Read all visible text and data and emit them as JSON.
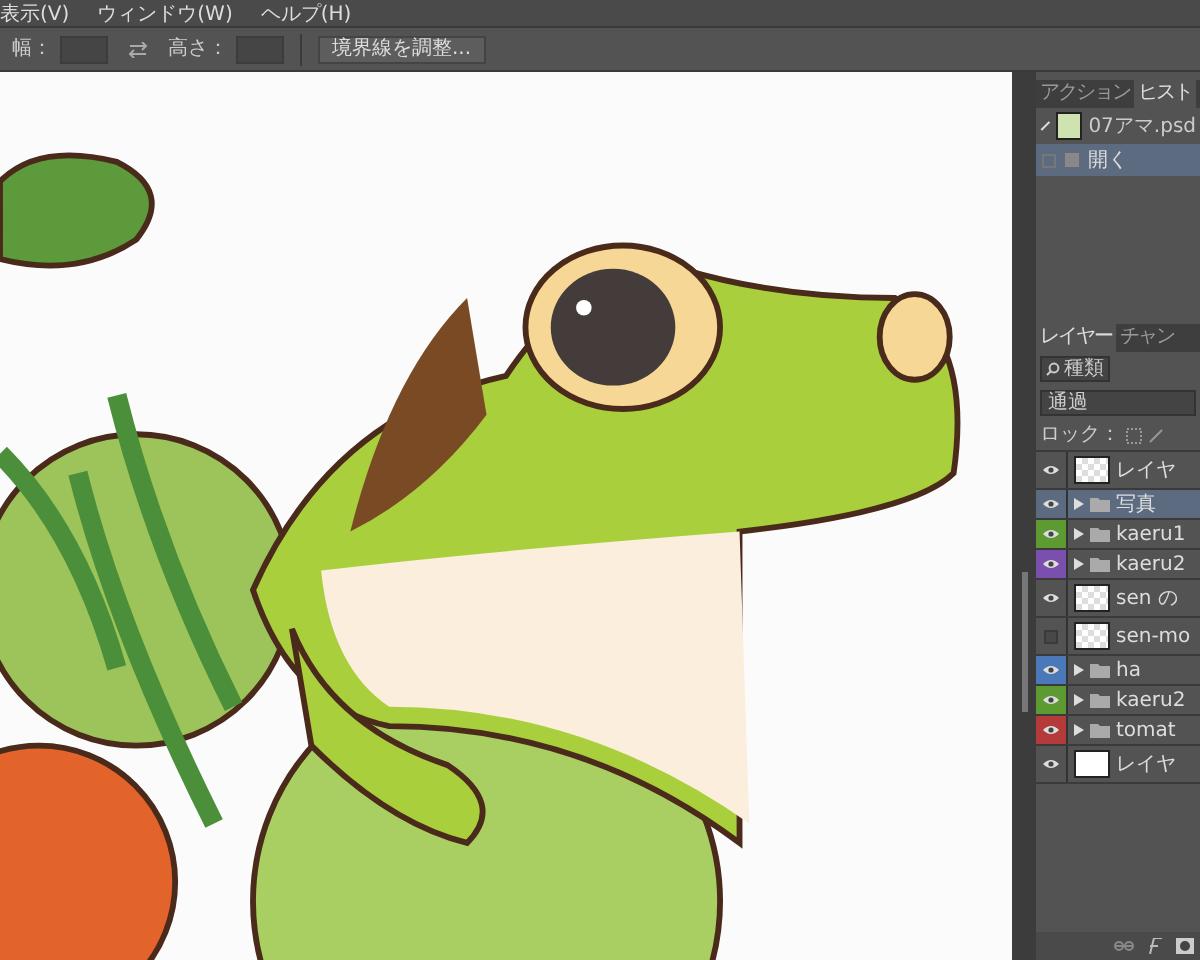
{
  "menu": [
    "表示(V)",
    "ウィンドウ(W)",
    "ヘルプ(H)"
  ],
  "options": {
    "width_label": "幅：",
    "height_label": "高さ：",
    "refine_button": "境界線を調整..."
  },
  "history_panel": {
    "tabs": [
      {
        "label": "アクション",
        "selected": false
      },
      {
        "label": "ヒスト",
        "selected": true
      }
    ],
    "snapshot": "07アマ.psd",
    "states": [
      {
        "label": "開く",
        "selected": true
      }
    ]
  },
  "layers_panel": {
    "tabs": [
      {
        "label": "レイヤー",
        "selected": true
      },
      {
        "label": "チャン",
        "selected": false
      }
    ],
    "filter": "種類",
    "blend_mode": "通過",
    "lock_label": "ロック：",
    "layers": [
      {
        "name": "レイヤ",
        "kind": "layer",
        "visible": true,
        "selected": false
      },
      {
        "name": "写真",
        "kind": "group",
        "visible": true,
        "selected": true
      },
      {
        "name": "kaeru1",
        "kind": "group",
        "visible": true,
        "selected": false,
        "color": "#5d9a32"
      },
      {
        "name": "kaeru2",
        "kind": "group",
        "visible": true,
        "selected": false,
        "color": "#7b4fae"
      },
      {
        "name": "sen の",
        "kind": "layer",
        "visible": true,
        "selected": false
      },
      {
        "name": "sen-mo",
        "kind": "layer",
        "visible": false,
        "selected": false
      },
      {
        "name": "ha",
        "kind": "group",
        "visible": true,
        "selected": false,
        "color": "#4a78b8"
      },
      {
        "name": "kaeru2",
        "kind": "group",
        "visible": true,
        "selected": false,
        "color": "#5d9a32"
      },
      {
        "name": "tomat",
        "kind": "group",
        "visible": true,
        "selected": false,
        "color": "#b53a3a"
      },
      {
        "name": "レイヤ",
        "kind": "background",
        "visible": true,
        "selected": false
      }
    ]
  }
}
